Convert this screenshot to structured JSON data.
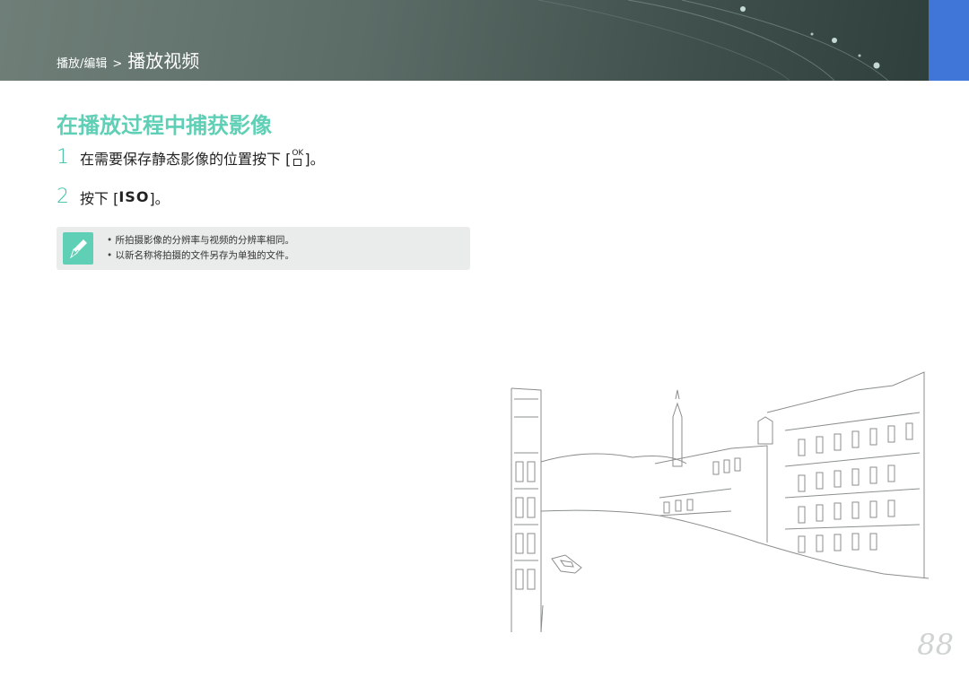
{
  "header": {
    "section": "播放/编辑",
    "separator": ">",
    "current": "播放视频"
  },
  "title": "在播放过程中捕获影像",
  "steps": [
    {
      "number": "1",
      "text_before": "在需要保存静态影像的位置按下 [",
      "key_top": "OK",
      "text_after": "]。"
    },
    {
      "number": "2",
      "text_before": "按下 [",
      "key": "ISO",
      "text_after": "]。"
    }
  ],
  "note": {
    "icon": "pen-note-icon",
    "items": [
      "所拍摄影像的分辨率与视频的分辨率相同。",
      "以新名称将拍摄的文件另存为单独的文件。"
    ]
  },
  "illustration": {
    "icon": "venice-canal-drawing"
  },
  "page_number": "88",
  "colors": {
    "accent": "#5fd0b6",
    "header_dark": "#3f504c",
    "tab_blue": "#3f76d8"
  }
}
